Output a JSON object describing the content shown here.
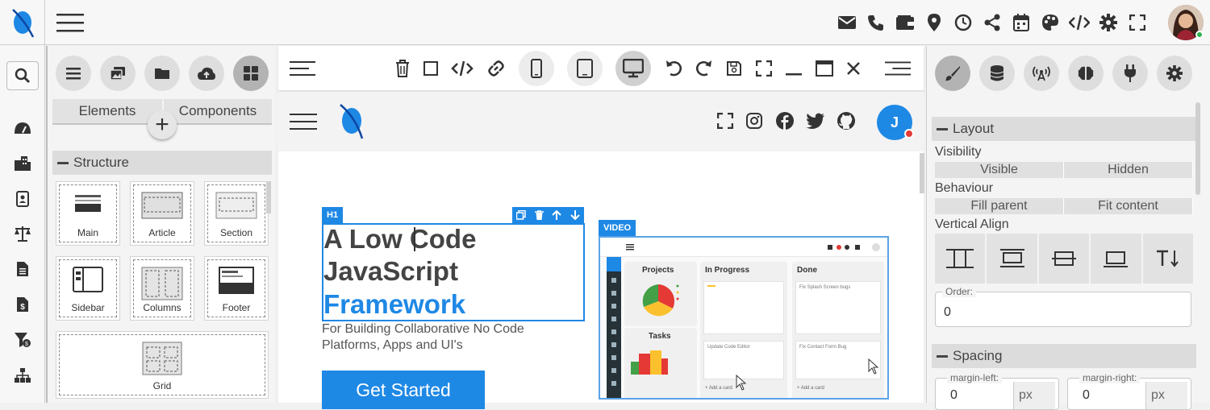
{
  "topbar": {
    "icons": [
      "mail-icon",
      "phone-icon",
      "wallet-icon",
      "map-pin-icon",
      "clock-icon",
      "share-icon",
      "calendar-icon",
      "palette-icon",
      "code-icon",
      "gear-icon",
      "fullscreen-icon"
    ]
  },
  "rail": {
    "icons": [
      "search-icon",
      "dashboard-icon",
      "building-icon",
      "contacts-icon",
      "scale-icon",
      "document-icon",
      "invoice-icon",
      "filter-money-icon",
      "sitemap-icon"
    ]
  },
  "left_panel": {
    "tool_icons": [
      "list-icon",
      "images-icon",
      "folder-icon",
      "cloud-upload-icon",
      "grid-icon"
    ],
    "tabs": [
      "Elements",
      "Components"
    ],
    "add_label": "+",
    "section_title": "Structure",
    "elements": [
      "Main",
      "Article",
      "Section",
      "Sidebar",
      "Columns",
      "Footer",
      "Grid"
    ]
  },
  "canvas_toolbar": {
    "icons": [
      "menu-icon",
      "trash-icon",
      "square-icon",
      "code-icon",
      "link-icon",
      "mobile-icon",
      "tablet-icon",
      "desktop-icon",
      "undo-icon",
      "redo-icon",
      "save-icon",
      "fullscreen-icon",
      "minimize-icon",
      "maximize-icon",
      "close-icon",
      "menu-right-icon"
    ]
  },
  "canvas": {
    "nav_icons": [
      "fullscreen-icon",
      "instagram-icon",
      "facebook-icon",
      "twitter-icon",
      "github-icon"
    ],
    "avatar_letter": "J",
    "h1_tag": "H1",
    "h1_line1": "A Low Code",
    "h1_line2": "JavaScript",
    "h1_line3": "Framework",
    "subtitle": "For Building Collaborative No Code Platforms, Apps and UI's",
    "cta": "Get Started",
    "video_tag": "VIDEO",
    "video": {
      "projects": "Projects",
      "tasks": "Tasks",
      "in_progress": "In Progress",
      "done": "Done",
      "card1": "Update Code Editor",
      "card2": "Fix Splash Screen bugs",
      "card3": "Fix Contact Form Bug",
      "add_card": "+ Add a card"
    }
  },
  "right_panel": {
    "tool_icons": [
      "brush-icon",
      "database-icon",
      "broadcast-icon",
      "brain-icon",
      "plug-icon",
      "gear-icon"
    ],
    "layout_title": "Layout",
    "visibility_label": "Visibility",
    "visibility_options": [
      "Visible",
      "Hidden"
    ],
    "behaviour_label": "Behaviour",
    "behaviour_options": [
      "Fill parent",
      "Fit content"
    ],
    "valign_label": "Vertical Align",
    "order_label": "Order:",
    "order_value": "0",
    "spacing_title": "Spacing",
    "margin_left_label": "margin-left:",
    "margin_left_value": "0",
    "margin_left_unit": "px",
    "margin_right_label": "margin-right:",
    "margin_right_value": "0",
    "margin_right_unit": "px"
  },
  "colors": {
    "accent": "#1e88e5",
    "panel": "#f4f4f4",
    "text": "#444444"
  }
}
